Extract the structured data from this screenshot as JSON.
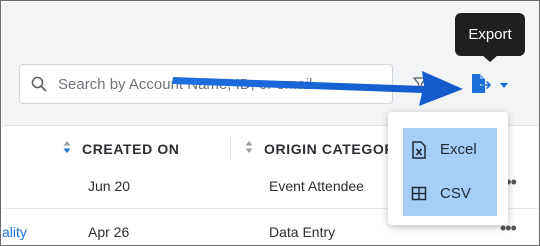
{
  "toolbar": {
    "search_placeholder": "Search by Account Name, ID, or email",
    "export_tooltip": "Export"
  },
  "table": {
    "columns": [
      "CREATED ON",
      "ORIGIN CATEGORY"
    ],
    "rows": [
      {
        "name_fragment": "",
        "created_on": "Jun 20",
        "origin_category": "Event Attendee"
      },
      {
        "name_fragment": "ality",
        "created_on": "Apr 26",
        "origin_category": "Data Entry"
      }
    ]
  },
  "export_menu": {
    "items": [
      {
        "label": "Excel",
        "icon": "excel-file-icon"
      },
      {
        "label": "CSV",
        "icon": "table-grid-icon"
      }
    ]
  },
  "colors": {
    "accent": "#1a6ed8",
    "menu_highlight": "#a5cff7",
    "tooltip_bg": "#1f1f1f",
    "annotation_arrow": "#1565d8"
  }
}
